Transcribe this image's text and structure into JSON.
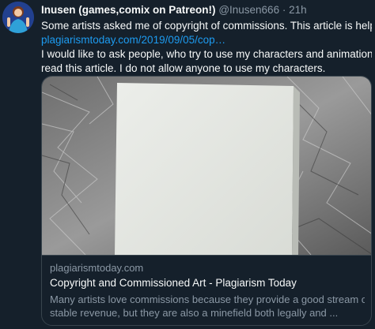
{
  "tweet": {
    "author_name": "Inusen (games,comix on Patreon!)",
    "handle": "@Inusen666",
    "separator": "·",
    "time": "21h",
    "line1": "Some artists asked me of copyright of commissions. This article is helpful:",
    "link": "plagiarismtoday.com/2019/09/05/cop…",
    "line3": "I would like to ask people, who try to use my characters and animations to",
    "line4": "read this article. I do not allow anyone to use my characters."
  },
  "card": {
    "domain": "plagiarismtoday.com",
    "title": "Copyright and Commissioned Art - Plagiarism Today",
    "desc_line1": "Many artists love commissions because they provide a good stream of",
    "desc_line2": "stable revenue, but they are also a minefield both legally and ..."
  },
  "colors": {
    "background": "#15202b",
    "text": "#f7f9f9",
    "secondary": "#8b98a5",
    "link": "#1d9bf0",
    "border": "#38444d"
  }
}
